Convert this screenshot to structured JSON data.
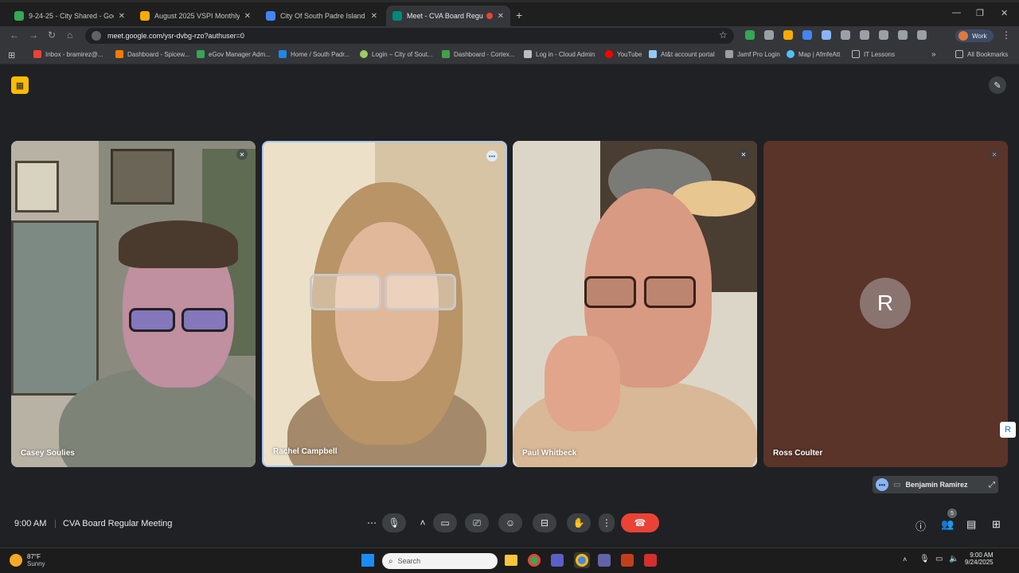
{
  "tabs": [
    {
      "title": "9-24-25 - City Shared - Google",
      "color": "#34a853"
    },
    {
      "title": "August 2025 VSPI Monthly Rep",
      "color": "#f9ab00"
    },
    {
      "title": "City Of South Padre Island - Ca",
      "color": "#4285f4"
    },
    {
      "title": "Meet - CVA Board Regular",
      "color": "#00897b"
    }
  ],
  "url": "meet.google.com/ysr-dvbg-rzo?authuser=0",
  "profile": "Work",
  "bookmarks": [
    {
      "label": "Inbox - bramirez@...",
      "color": "#ea4335"
    },
    {
      "label": "Dashboard - Spicew...",
      "color": "#f57c00"
    },
    {
      "label": "eGov Manager Adm...",
      "color": "#34a853"
    },
    {
      "label": "Home / South Padr...",
      "color": "#1e88e5"
    },
    {
      "label": "Login – City of Sout...",
      "color": "#9ccc65"
    },
    {
      "label": "Dashboard - Cortex...",
      "color": "#43a047"
    },
    {
      "label": "Log in - Cloud Admin",
      "color": "#bdbdbd"
    },
    {
      "label": "YouTube",
      "color": "#ff0000"
    },
    {
      "label": "At&t account portal",
      "color": "#90caf9"
    },
    {
      "label": "Jamf Pro Login",
      "color": "#9e9e9e"
    },
    {
      "label": "Map | AfmfeAtt",
      "color": "#4fc3f7"
    },
    {
      "label": "IT Lessons",
      "color": "#bdbdbd"
    }
  ],
  "all_bookmarks": "All Bookmarks",
  "participants": [
    {
      "name": "Casey Soulies"
    },
    {
      "name": "Rachel Campbell"
    },
    {
      "name": "Paul Whitbeck"
    },
    {
      "name": "Ross Coulter",
      "initial": "R"
    }
  ],
  "self_view": "Benjamin Ramirez",
  "meeting": {
    "time": "9:00 AM",
    "title": "CVA Board Regular Meeting"
  },
  "participant_count": "5",
  "weather": {
    "temp": "87°F",
    "desc": "Sunny"
  },
  "taskbar_search": "Search",
  "clock": {
    "time": "9:00 AM",
    "date": "9/24/2025"
  }
}
